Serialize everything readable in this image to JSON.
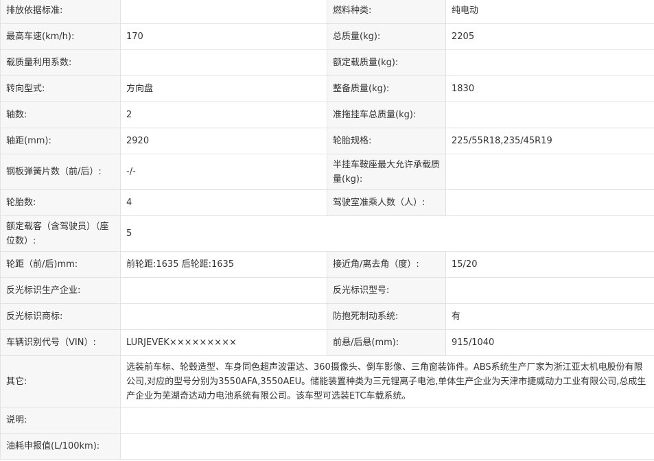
{
  "rows": [
    {
      "l1": "排放依据标准:",
      "v1": "",
      "l2": "燃料种类:",
      "v2": "纯电动"
    },
    {
      "l1": "最高车速(km/h):",
      "v1": "170",
      "l2": "总质量(kg):",
      "v2": "2205"
    },
    {
      "l1": "载质量利用系数:",
      "v1": "",
      "l2": "额定载质量(kg):",
      "v2": ""
    },
    {
      "l1": "转向型式:",
      "v1": "方向盘",
      "l2": "整备质量(kg):",
      "v2": "1830"
    },
    {
      "l1": "轴数:",
      "v1": "2",
      "l2": "准拖挂车总质量(kg):",
      "v2": ""
    },
    {
      "l1": "轴距(mm):",
      "v1": "2920",
      "l2": "轮胎规格:",
      "v2": "225/55R18,235/45R19"
    },
    {
      "l1": "钢板弹簧片数（前/后）:",
      "v1": "-/-",
      "l2": "半挂车鞍座最大允许承载质量(kg):",
      "v2": ""
    },
    {
      "l1": "轮胎数:",
      "v1": "4",
      "l2": "驾驶室准乘人数（人）:",
      "v2": ""
    },
    {
      "l1": "额定载客（含驾驶员）（座位数）:",
      "v1": "5"
    },
    {
      "l1": "轮距（前/后)mm:",
      "v1": "前轮距:1635 后轮距:1635",
      "l2": "接近角/离去角（度）:",
      "v2": "15/20"
    },
    {
      "l1": "反光标识生产企业:",
      "v1": "",
      "l2": "反光标识型号:",
      "v2": ""
    },
    {
      "l1": "反光标识商标:",
      "v1": "",
      "l2": "防抱死制动系统:",
      "v2": "有"
    },
    {
      "l1": "车辆识别代号（VIN）:",
      "v1": "LURJEVEK×××××××××",
      "l2": "前悬/后悬(mm):",
      "v2": "915/1040"
    },
    {
      "l1": "其它:",
      "v1": "选装前车标、轮毂造型、车身同色超声波雷达、360摄像头、倒车影像、三角窗装饰件。ABS系统生产厂家为浙江亚太机电股份有限公司,对应的型号分别为3550AFA,3550AEU。储能装置种类为三元锂离子电池,单体生产企业为天津市捷威动力工业有限公司,总成生产企业为芜湖奇达动力电池系统有限公司。该车型可选装ETC车载系统。"
    },
    {
      "l1": "说明:",
      "v1": ""
    },
    {
      "l1": "油耗申报值(L/100km):",
      "v1": ""
    }
  ]
}
